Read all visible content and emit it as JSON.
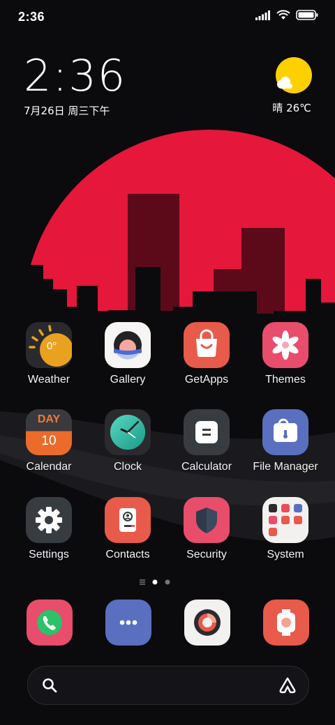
{
  "status_bar": {
    "time": "2:36"
  },
  "clock_widget": {
    "time": "2:36",
    "date": "7月26日 周三下午"
  },
  "weather_widget": {
    "text": "晴 26℃"
  },
  "apps": [
    {
      "label": "Weather",
      "icon": "weather-icon",
      "badge": "0°"
    },
    {
      "label": "Gallery",
      "icon": "gallery-icon"
    },
    {
      "label": "GetApps",
      "icon": "getapps-icon"
    },
    {
      "label": "Themes",
      "icon": "themes-icon"
    },
    {
      "label": "Calendar",
      "icon": "calendar-icon",
      "top": "DAY",
      "num": "10"
    },
    {
      "label": "Clock",
      "icon": "clock-icon"
    },
    {
      "label": "Calculator",
      "icon": "calculator-icon"
    },
    {
      "label": "File Manager",
      "icon": "file-manager-icon"
    },
    {
      "label": "Settings",
      "icon": "gear-icon"
    },
    {
      "label": "Contacts",
      "icon": "contacts-icon"
    },
    {
      "label": "Security",
      "icon": "shield-icon"
    },
    {
      "label": "System",
      "icon": "folder-icon"
    }
  ],
  "page_indicator": {
    "pages": 2,
    "current": 1
  },
  "dock": [
    "phone-icon",
    "messages-icon",
    "camera-icon",
    "screen-recorder-icon"
  ],
  "colors": {
    "sun": "#e5173a",
    "background": "#0b0b0e",
    "accent_red": "#e85a4a"
  }
}
